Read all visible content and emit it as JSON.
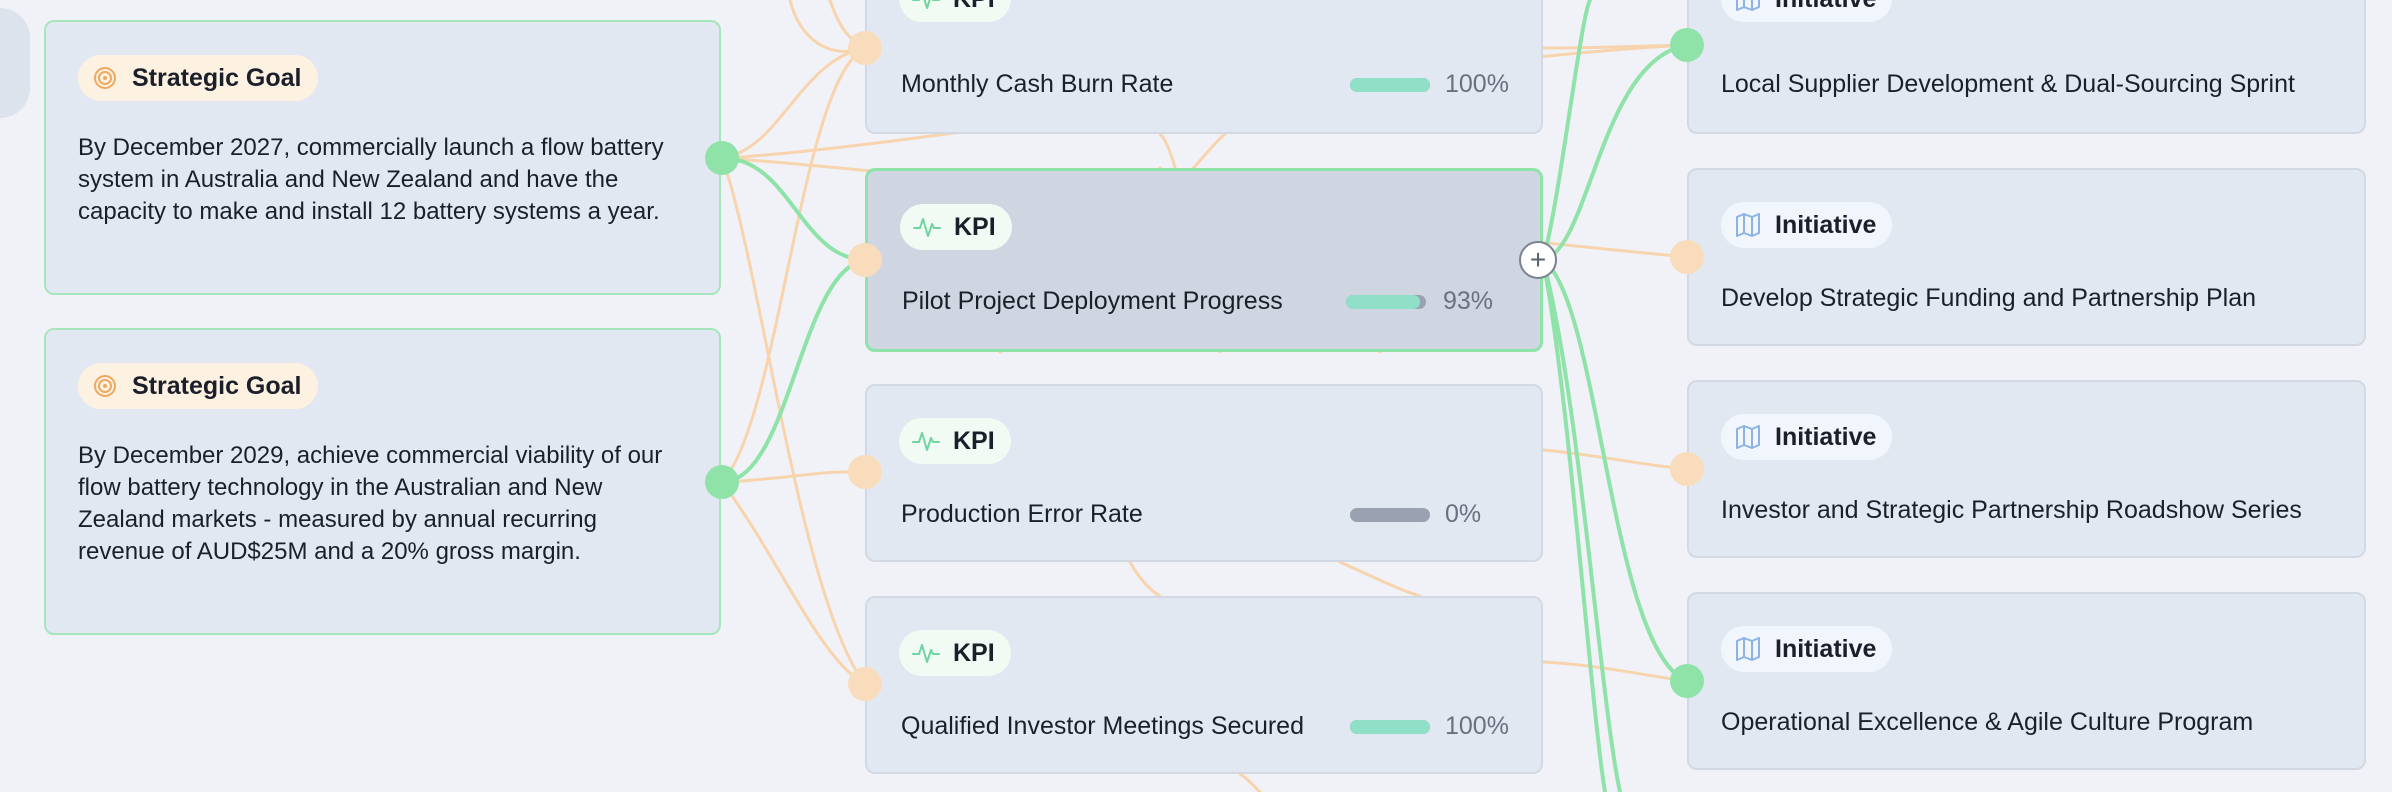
{
  "colors": {
    "edge_green": "#8fe3a9",
    "edge_orange": "#f8d4ae",
    "progress_fill": "#8fe0c6",
    "progress_track": "#9aa1b1"
  },
  "goals": [
    {
      "badge_label": "Strategic Goal",
      "icon": "target-icon",
      "text": "By December 2027, commercially launch a flow battery system in Australia and New Zealand and have the capacity to make and install 12 battery systems a year."
    },
    {
      "badge_label": "Strategic Goal",
      "icon": "target-icon",
      "text": "By December 2029, achieve commercial viability of our flow battery technology in the Australian and New Zealand markets - measured by annual recurring revenue of AUD$25M and a 20% gross margin."
    }
  ],
  "kpis": [
    {
      "badge_label": "KPI",
      "icon": "pulse-icon",
      "title": "Monthly Cash Burn Rate",
      "progress": 100,
      "progress_label": "100%"
    },
    {
      "badge_label": "KPI",
      "icon": "pulse-icon",
      "title": "Pilot Project Deployment Progress",
      "progress": 93,
      "progress_label": "93%",
      "selected": true
    },
    {
      "badge_label": "KPI",
      "icon": "pulse-icon",
      "title": "Production Error Rate",
      "progress": 0,
      "progress_label": "0%"
    },
    {
      "badge_label": "KPI",
      "icon": "pulse-icon",
      "title": "Qualified Investor Meetings Secured",
      "progress": 100,
      "progress_label": "100%"
    }
  ],
  "initiatives": [
    {
      "badge_label": "Initiative",
      "icon": "map-icon",
      "title": "Local Supplier Development & Dual-Sourcing Sprint"
    },
    {
      "badge_label": "Initiative",
      "icon": "map-icon",
      "title": "Develop Strategic Funding and Partnership Plan"
    },
    {
      "badge_label": "Initiative",
      "icon": "map-icon",
      "title": "Investor and Strategic Partnership Roadshow Series"
    },
    {
      "badge_label": "Initiative",
      "icon": "map-icon",
      "title": "Operational Excellence & Agile Culture Program"
    }
  ],
  "add_button": {
    "icon": "plus-icon",
    "symbol": "+"
  }
}
